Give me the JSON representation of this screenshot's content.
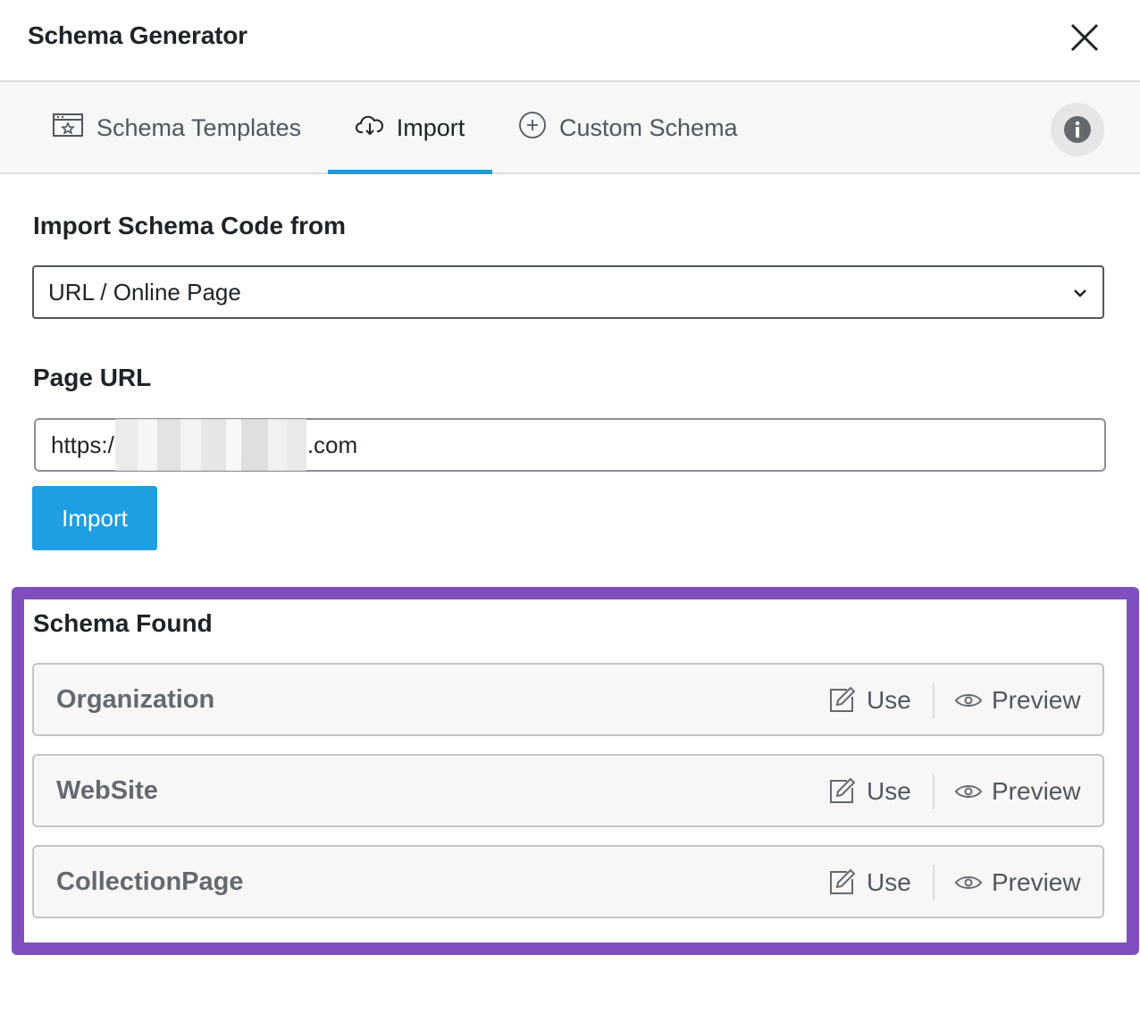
{
  "dialog": {
    "title": "Schema Generator"
  },
  "tabs": [
    {
      "label": "Schema Templates",
      "icon": "schema-templates-icon"
    },
    {
      "label": "Import",
      "icon": "cloud-download-icon",
      "active": true
    },
    {
      "label": "Custom Schema",
      "icon": "plus-circle-icon"
    }
  ],
  "form": {
    "source_label": "Import Schema Code from",
    "source_value": "URL / Online Page",
    "url_label": "Page URL",
    "url_prefix": "https:/",
    "url_suffix": ".com",
    "import_button": "Import"
  },
  "found": {
    "title": "Schema Found",
    "items": [
      {
        "name": "Organization",
        "use": "Use",
        "preview": "Preview"
      },
      {
        "name": "WebSite",
        "use": "Use",
        "preview": "Preview"
      },
      {
        "name": "CollectionPage",
        "use": "Use",
        "preview": "Preview"
      }
    ]
  },
  "colors": {
    "accent": "#1e9cd7",
    "button": "#1e9ee3",
    "highlight_border": "#7f4fbf"
  }
}
